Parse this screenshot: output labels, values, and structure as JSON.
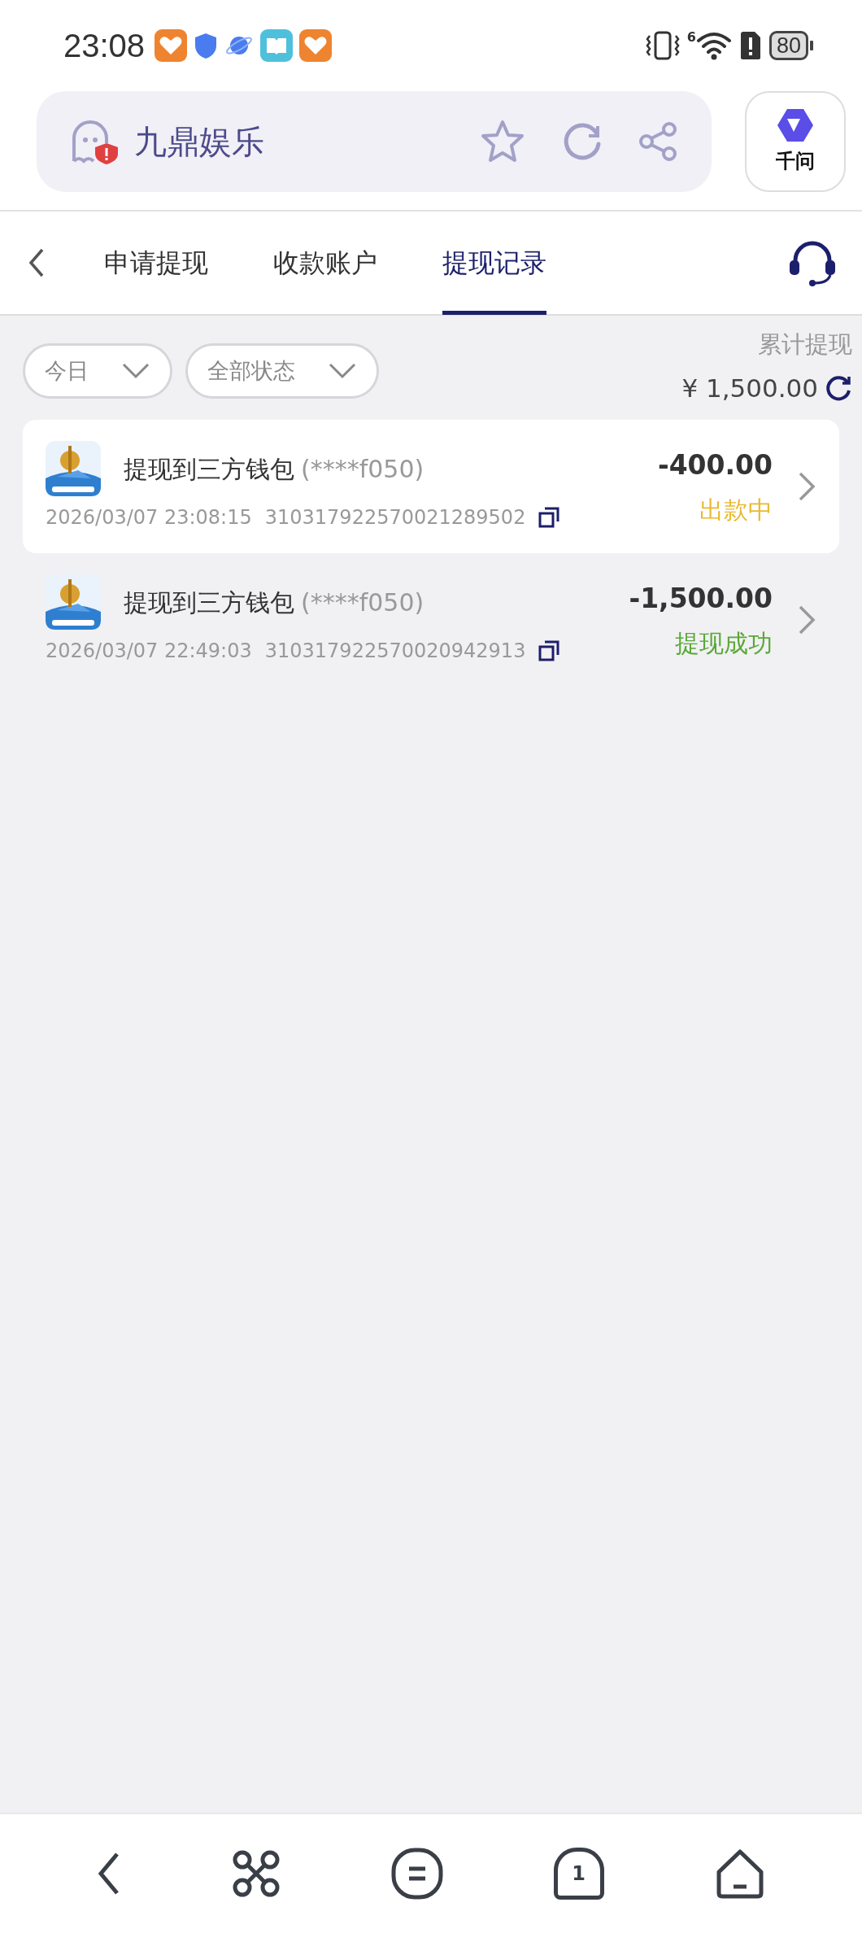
{
  "status_bar": {
    "time": "23:08",
    "network_label": "6",
    "battery": "80"
  },
  "address_bar": {
    "title": "九鼎娱乐",
    "assistant_label": "千问"
  },
  "tabs": [
    {
      "label": "申请提现",
      "selected": false
    },
    {
      "label": "收款账户",
      "selected": false
    },
    {
      "label": "提现记录",
      "selected": true
    }
  ],
  "filters": [
    {
      "label": "今日"
    },
    {
      "label": "全部状态"
    }
  ],
  "summary": {
    "label": "累计提现",
    "amount": "¥ 1,500.00"
  },
  "records": [
    {
      "title": "提现到三方钱包",
      "account": "(****f050)",
      "datetime": "2026/03/07 23:08:15",
      "order_no": "310317922570021289502",
      "amount": "-400.00",
      "status": "出款中",
      "color": "#e8b930",
      "selected": true
    },
    {
      "title": "提现到三方钱包",
      "account": "(****f050)",
      "datetime": "2026/03/07 22:49:03",
      "order_no": "310317922570020942913",
      "amount": "-1,500.00",
      "status": "提现成功",
      "color": "#5aa838",
      "selected": false
    }
  ],
  "nav_bar": {
    "tab_count": "1"
  }
}
